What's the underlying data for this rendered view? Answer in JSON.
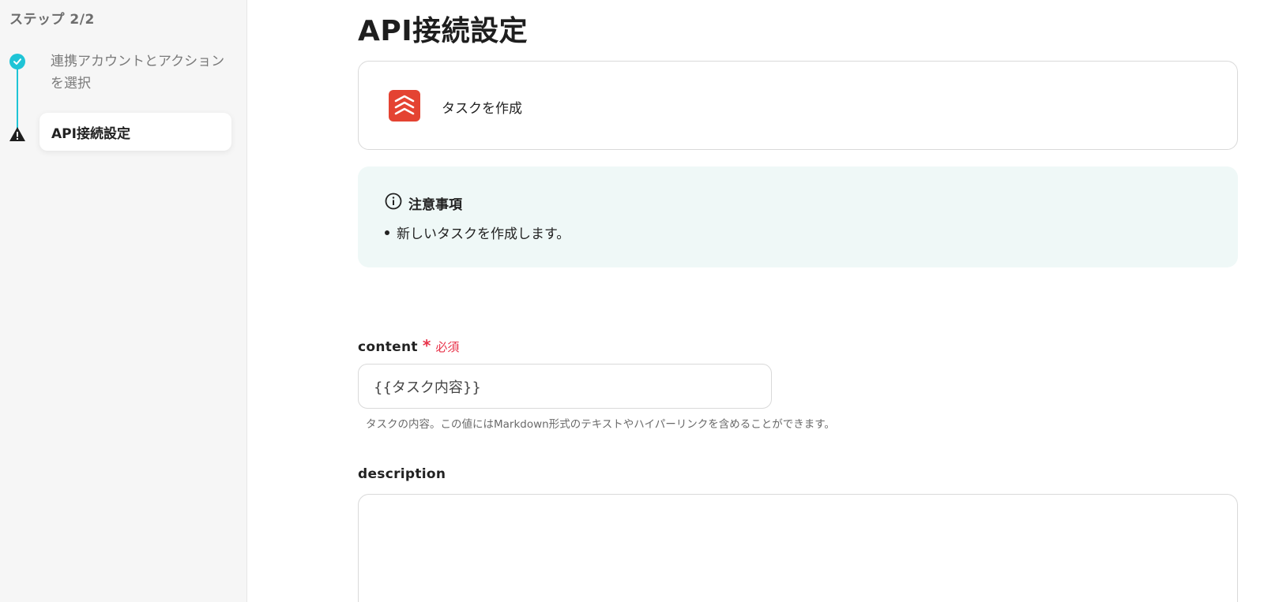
{
  "sidebar": {
    "step_counter": "ステップ 2/2",
    "steps": [
      {
        "label": "連携アカウントとアクションを選択",
        "status": "done"
      },
      {
        "label": "API接続設定",
        "status": "warning",
        "active": true
      }
    ]
  },
  "main": {
    "title": "API接続設定",
    "action": {
      "icon": "todoist-icon",
      "label": "タスクを作成"
    },
    "notice": {
      "title": "注意事項",
      "items": [
        "新しいタスクを作成します。"
      ]
    },
    "fields": {
      "content": {
        "name": "content",
        "required_mark": "*",
        "required_text": "必須",
        "value": "{{タスク内容}}",
        "hint": "タスクの内容。この値にはMarkdown形式のテキストやハイパーリンクを含めることができます。"
      },
      "description": {
        "name": "description",
        "value": ""
      }
    }
  },
  "colors": {
    "accent": "#1fc4d6",
    "required": "#e8334a",
    "todoist": "#e44332",
    "notice_bg": "#eff8f7"
  }
}
